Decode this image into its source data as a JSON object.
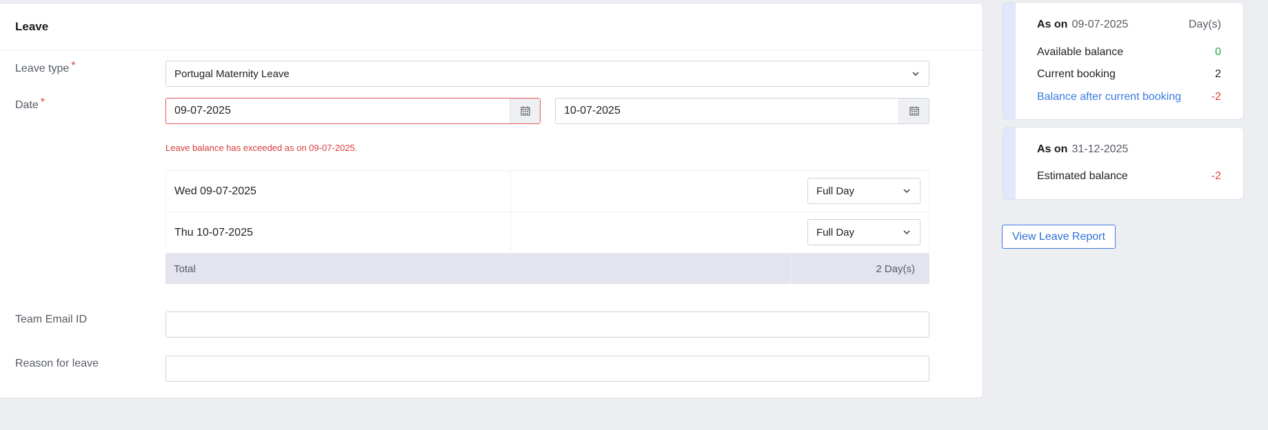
{
  "form": {
    "title": "Leave",
    "leave_type": {
      "label": "Leave type",
      "required_mark": "*",
      "value": "Portugal Maternity Leave"
    },
    "date": {
      "label": "Date",
      "required_mark": "*",
      "from": "09-07-2025",
      "to": "10-07-2025",
      "error": "Leave balance has exceeded as on 09-07-2025."
    },
    "days": [
      {
        "date": "Wed 09-07-2025",
        "type": "Full Day"
      },
      {
        "date": "Thu 10-07-2025",
        "type": "Full Day"
      }
    ],
    "total": {
      "label": "Total",
      "value": "2 Day(s)"
    },
    "team_email": {
      "label": "Team Email ID",
      "value": ""
    },
    "reason": {
      "label": "Reason for leave",
      "value": ""
    }
  },
  "balance_current": {
    "as_on_label": "As on",
    "as_on_date": "09-07-2025",
    "unit": "Day(s)",
    "rows": [
      {
        "label": "Available balance",
        "value": "0"
      },
      {
        "label": "Current booking",
        "value": "2"
      },
      {
        "label": "Balance after current booking",
        "value": "-2"
      }
    ]
  },
  "balance_estimated": {
    "as_on_label": "As on",
    "as_on_date": "31-12-2025",
    "rows": [
      {
        "label": "Estimated balance",
        "value": "-2"
      }
    ]
  },
  "actions": {
    "view_report": "View Leave Report"
  },
  "colors": {
    "accent": "#3a7be0",
    "error": "#e23b3b",
    "success": "#23a84b",
    "total_bg": "#e4e4ee"
  }
}
